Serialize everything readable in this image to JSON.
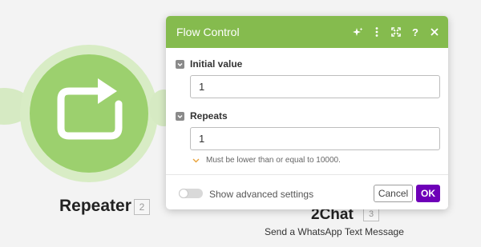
{
  "canvas": {
    "module": {
      "name": "Repeater",
      "badge": "2",
      "icon": "repeat-icon",
      "color": "#9cd06e"
    },
    "next_module": {
      "name": "2Chat",
      "badge": "3",
      "description": "Send a WhatsApp Text Message"
    }
  },
  "dialog": {
    "title": "Flow Control",
    "header_color": "#85bb4e",
    "header_icons": [
      "ai-sparkle-icon",
      "more-vertical-icon",
      "expand-icon",
      "help-icon",
      "close-icon"
    ],
    "fields": [
      {
        "label": "Initial value",
        "value": "1"
      },
      {
        "label": "Repeats",
        "value": "1",
        "hint": "Must be lower than or equal to 10000."
      }
    ],
    "footer": {
      "advanced_label": "Show advanced settings",
      "advanced_enabled": false,
      "cancel_label": "Cancel",
      "ok_label": "OK",
      "ok_color": "#6e00b8"
    }
  }
}
